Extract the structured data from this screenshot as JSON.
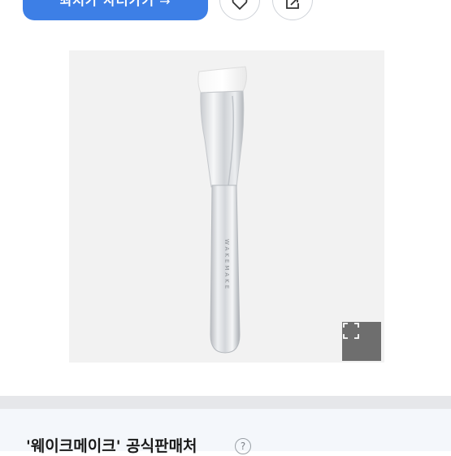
{
  "top_actions": {
    "cta_label": "최저가 사러가기",
    "cta_arrow": "→",
    "wish_icon": "heart-icon",
    "share_icon": "share-icon"
  },
  "product_image": {
    "brand_print": "WAKEMAKE",
    "zoom_icon": "expand-icon"
  },
  "seller": {
    "title": "'웨이크메이크' 공식판매처",
    "help_icon_text": "?"
  }
}
